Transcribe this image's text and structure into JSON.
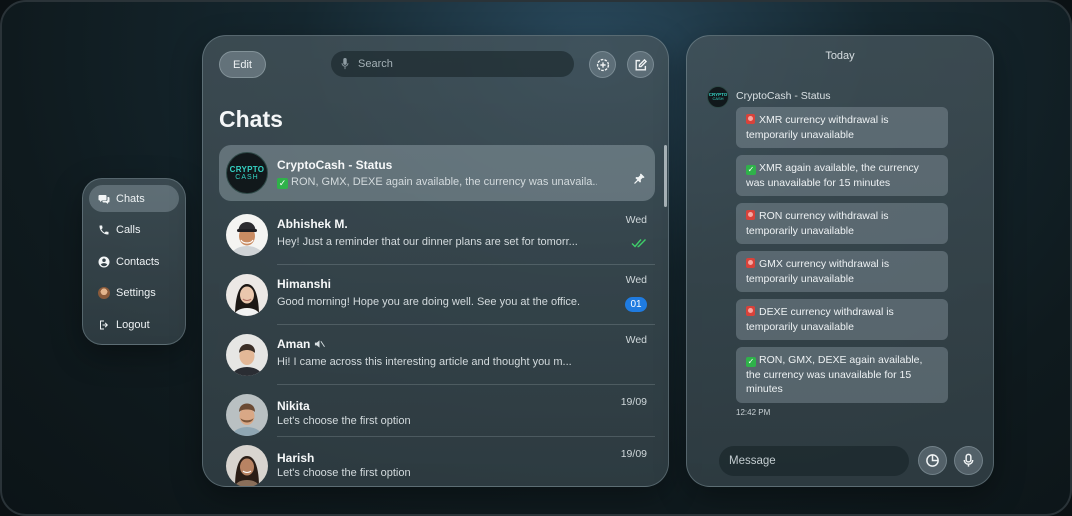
{
  "nav": {
    "items": [
      {
        "label": "Chats",
        "icon": "chat-bubbles-icon",
        "active": true
      },
      {
        "label": "Calls",
        "icon": "phone-icon",
        "active": false
      },
      {
        "label": "Contacts",
        "icon": "person-icon",
        "active": false
      },
      {
        "label": "Settings",
        "icon": "avatar-icon",
        "active": false
      },
      {
        "label": "Logout",
        "icon": "logout-icon",
        "active": false
      }
    ]
  },
  "chats": {
    "edit_label": "Edit",
    "search_placeholder": "Search",
    "title": "Chats",
    "list": [
      {
        "name": "CryptoCash - Status",
        "preview": "RON, GMX, DEXE again available, the currency was unavaila...",
        "time": "",
        "pinned": true,
        "status": "pinned",
        "avatar_text_1": "CRYPTO",
        "avatar_text_2": "CASH"
      },
      {
        "name": "Abhishek M.",
        "preview": "Hey! Just a reminder that our dinner plans are set for tomorr...",
        "time": "Wed",
        "status": "read"
      },
      {
        "name": "Himanshi",
        "preview": "Good morning! Hope you are doing well. See you at the office.",
        "time": "Wed",
        "status": "unread",
        "unread_count": "01"
      },
      {
        "name": "Aman",
        "preview": "Hi! I came across this interesting article and thought you m...",
        "time": "Wed",
        "status": "muted"
      },
      {
        "name": "Nikita",
        "preview": "Let's choose the first option",
        "time": "19/09",
        "status": "none"
      },
      {
        "name": "Harish",
        "preview": "Let's choose the first option",
        "time": "19/09",
        "status": "none"
      }
    ]
  },
  "conversation": {
    "date_label": "Today",
    "sender": "CryptoCash - Status",
    "avatar_text_1": "CRYPTO",
    "avatar_text_2": "CASH",
    "messages": [
      {
        "type": "alert",
        "text": "XMR currency withdrawal is temporarily unavailable"
      },
      {
        "type": "ok",
        "text": "XMR again available, the currency was unavailable for 15 minutes"
      },
      {
        "type": "alert",
        "text": "RON currency withdrawal is temporarily unavailable"
      },
      {
        "type": "alert",
        "text": "GMX currency withdrawal is temporarily unavailable"
      },
      {
        "type": "alert",
        "text": "DEXE currency withdrawal is temporarily unavailable"
      },
      {
        "type": "ok",
        "text": "RON, GMX, DEXE again available, the currency was unavailable for 15 minutes"
      }
    ],
    "last_time": "12:42 PM",
    "message_placeholder": "Message"
  },
  "colors": {
    "accent_blue": "#1f7be0",
    "ok_green": "#2fb24a",
    "brand_teal": "#35d3c4"
  }
}
